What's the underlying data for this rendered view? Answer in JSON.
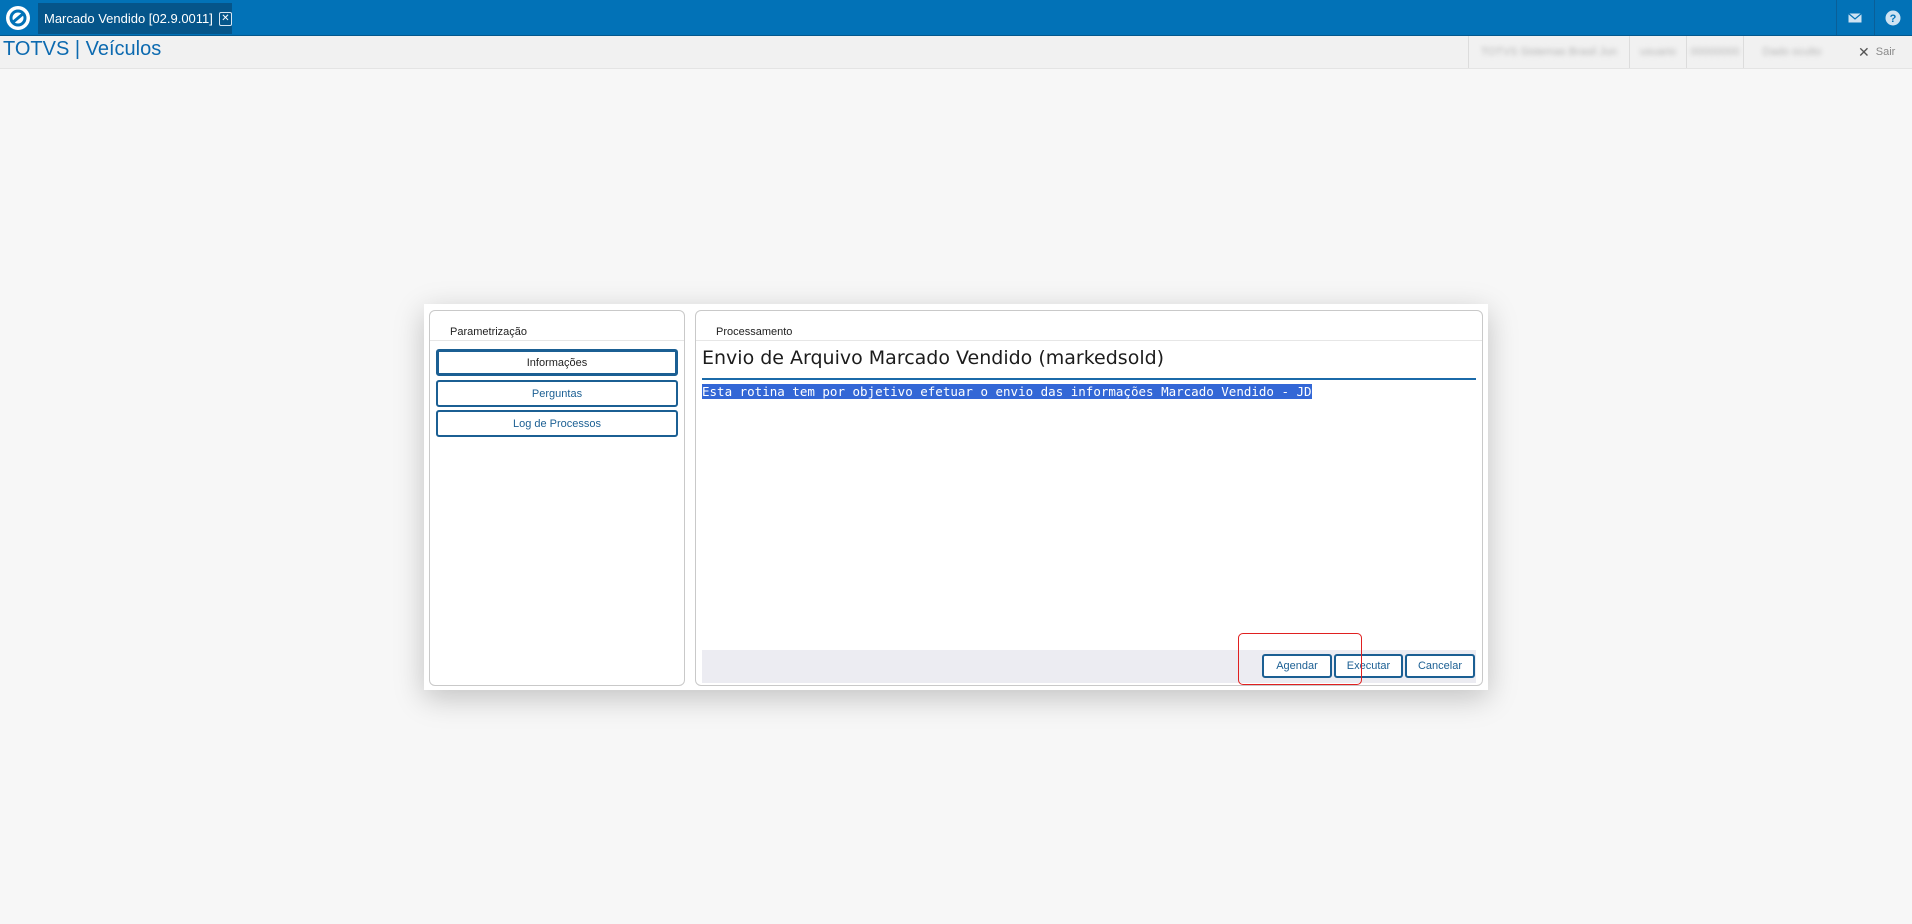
{
  "topbar": {
    "tab_label": "Marcado Vendido [02.9.0011]",
    "tab_close_glyph": "✕",
    "mail_icon": "mail-icon",
    "help_icon": "help-icon"
  },
  "header": {
    "app_title": "TOTVS | Veículos",
    "user_info": [
      "TOTVS Sistemas Brasil Jun",
      "usuario",
      "00000000",
      "Dado oculto"
    ],
    "logout_label": "Sair"
  },
  "dialog": {
    "left_panel": {
      "title": "Parametrização",
      "items": [
        {
          "label": "Informações",
          "active": true
        },
        {
          "label": "Perguntas",
          "active": false
        },
        {
          "label": "Log de Processos",
          "active": false
        }
      ]
    },
    "right_panel": {
      "title": "Processamento",
      "heading": "Envio de Arquivo Marcado Vendido (markedsold)",
      "description": "Esta rotina tem por objetivo efetuar o envio das informações Marcado Vendido - JD"
    },
    "actions": {
      "agendar": "Agendar",
      "executar": "Executar",
      "cancelar": "Cancelar"
    }
  },
  "colors": {
    "topbar": "#0272b7",
    "accent": "#1b5f93",
    "highlight": "#e02020",
    "selection": "#3367d6"
  }
}
